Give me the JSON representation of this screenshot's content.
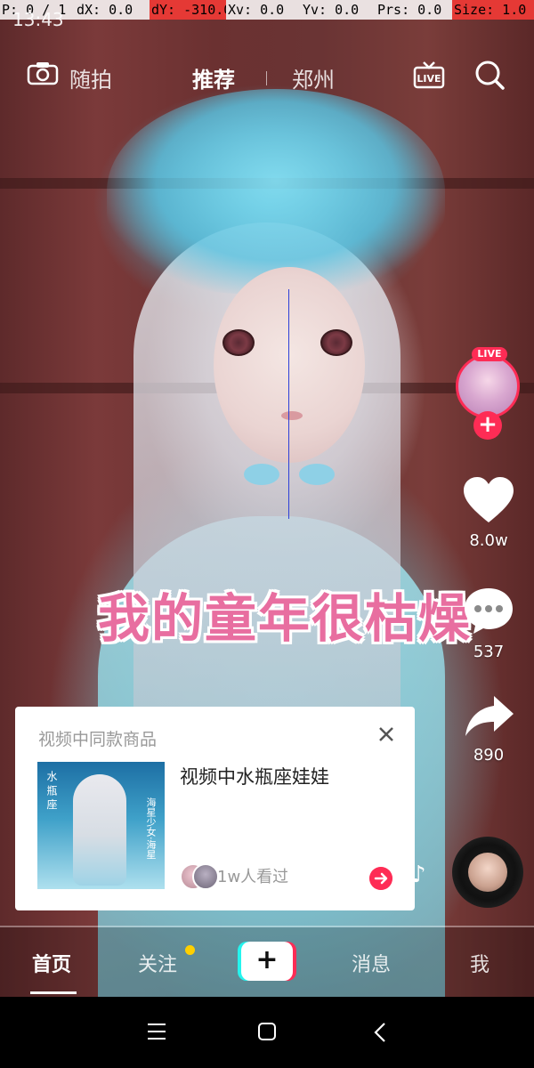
{
  "debug": {
    "p": "P: 0 / 1",
    "dx": "dX: 0.0",
    "dy": "dY: -310.0",
    "xv": "Xv: 0.0",
    "yv": "Yv: 0.0",
    "prs": "Prs: 0.0",
    "size": "Size: 1.0"
  },
  "status": {
    "time": "13:43"
  },
  "top_nav": {
    "random_label": "随拍",
    "recommend_label": "推荐",
    "city_label": "郑州",
    "live_label": "LIVE"
  },
  "video": {
    "caption": "我的童年很枯燥"
  },
  "actions": {
    "live_badge": "LIVE",
    "likes": "8.0w",
    "comments": "537",
    "shares": "890"
  },
  "product_card": {
    "title": "视频中同款商品",
    "name": "视频中水瓶座娃娃",
    "viewers": "1w人看过",
    "image_text_left": "水 瓶 座",
    "image_text_right": "海星少女·海星"
  },
  "bottom_nav": {
    "home": "首页",
    "follow": "关注",
    "messages": "消息",
    "me": "我"
  },
  "colors": {
    "accent": "#fe2c55",
    "cyan": "#25f4ee",
    "notify_dot": "#ffd000"
  }
}
